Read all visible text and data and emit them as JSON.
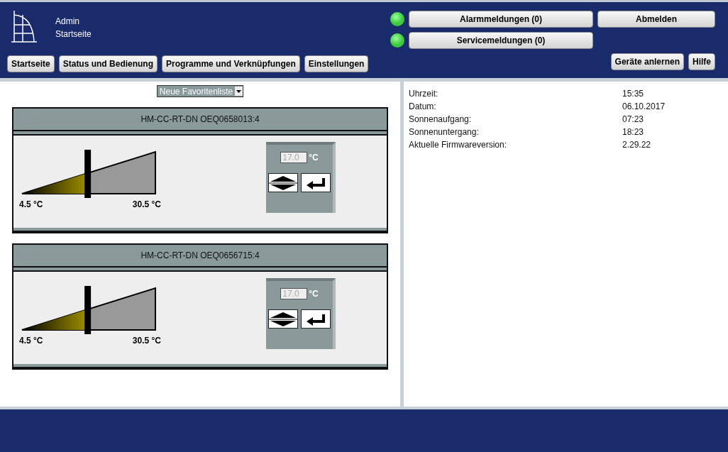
{
  "header": {
    "user": "Admin",
    "page": "Startseite"
  },
  "nav": [
    "Startseite",
    "Status und Bedienung",
    "Programme und Verknüpfungen",
    "Einstellungen"
  ],
  "messages": [
    {
      "label": "Alarmmeldungen (0)",
      "color": "#3cc83c"
    },
    {
      "label": "Servicemeldungen (0)",
      "color": "#3cc83c"
    }
  ],
  "logout": "Abmelden",
  "right_buttons": [
    "Geräte anlernen",
    "Hilfe"
  ],
  "favorites_select": {
    "value": "Neue Favoritenliste"
  },
  "devices": [
    {
      "title": "HM-CC-RT-DN OEQ0658013:4",
      "min_label": "4.5 °C",
      "max_label": "30.5 °C",
      "level": 0.49,
      "setpoint": "17.0",
      "unit": "°C"
    },
    {
      "title": "HM-CC-RT-DN OEQ0656715:4",
      "min_label": "4.5 °C",
      "max_label": "30.5 °C",
      "level": 0.49,
      "setpoint": "17.0",
      "unit": "°C"
    }
  ],
  "info": [
    {
      "label": "Uhrzeit:",
      "value": "15:35"
    },
    {
      "label": "Datum:",
      "value": "06.10.2017"
    },
    {
      "label": "Sonnenaufgang:",
      "value": "07:23"
    },
    {
      "label": "Sonnenuntergang:",
      "value": "18:23"
    },
    {
      "label": "Aktuelle Firmwareversion:",
      "value": "2.29.22"
    }
  ]
}
